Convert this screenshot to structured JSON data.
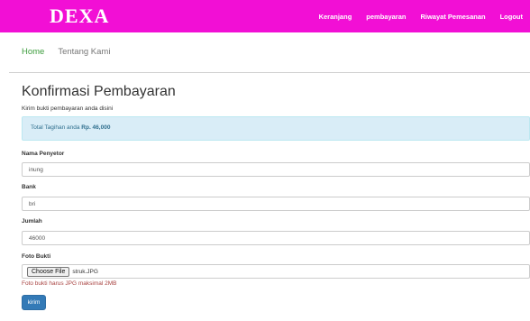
{
  "navbar": {
    "brand": "DEXA",
    "links": [
      "Keranjang",
      "pembayaran",
      "Riwayat Pemesanan",
      "Logout"
    ]
  },
  "breadcrumb": {
    "home": "Home",
    "current": "Tentang Kami"
  },
  "page": {
    "title": "Konfirmasi Pembayaran",
    "subtitle": "Kirim bukti pembayaran anda disini"
  },
  "alert": {
    "prefix": "Total Tagihan anda",
    "amount": "Rp. 46,000"
  },
  "form": {
    "nama": {
      "label": "Nama Penyetor",
      "value": "inung"
    },
    "bank": {
      "label": "Bank",
      "value": "bri"
    },
    "jumlah": {
      "label": "Jumlah",
      "value": "46000"
    },
    "foto": {
      "label": "Foto Bukti",
      "button": "Choose File",
      "filename": "struk.JPG",
      "help": "Foto bukti harus JPG maksimal 2MB"
    },
    "submit": "kirim"
  }
}
